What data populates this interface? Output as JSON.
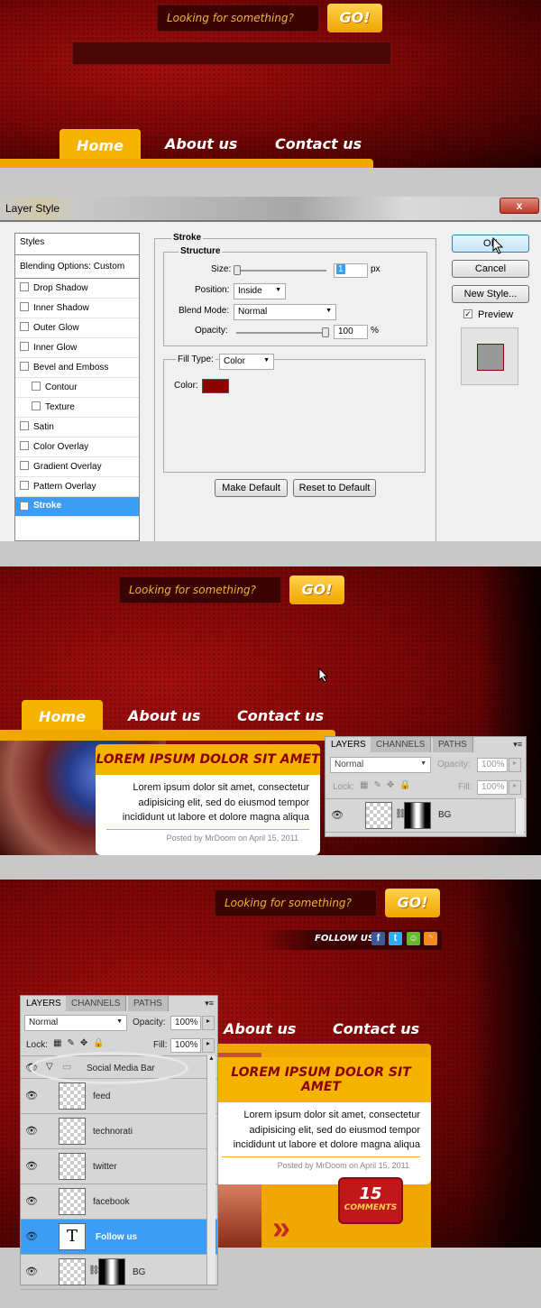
{
  "header": {
    "search_placeholder": "Looking for something?",
    "go_label": "GO!"
  },
  "nav": {
    "home": "Home",
    "about": "About us",
    "contact": "Contact us"
  },
  "dialog": {
    "title": "Layer Style",
    "close": "x",
    "styles_header": "Styles",
    "blending": "Blending Options: Custom",
    "items": [
      "Drop Shadow",
      "Inner Shadow",
      "Outer Glow",
      "Inner Glow",
      "Bevel and Emboss",
      "Contour",
      "Texture",
      "Satin",
      "Color Overlay",
      "Gradient Overlay",
      "Pattern Overlay",
      "Stroke"
    ],
    "stroke_title": "Stroke",
    "structure_title": "Structure",
    "size_label": "Size:",
    "size_value": "1",
    "size_unit": "px",
    "position_label": "Position:",
    "position_value": "Inside",
    "blend_label": "Blend Mode:",
    "blend_value": "Normal",
    "opacity_label": "Opacity:",
    "opacity_value": "100",
    "opacity_unit": "%",
    "filltype_label": "Fill Type:",
    "filltype_value": "Color",
    "color_label": "Color:",
    "stroke_color": "#8b0000",
    "make_default": "Make Default",
    "reset_default": "Reset to Default",
    "ok": "OK",
    "cancel": "Cancel",
    "new_style": "New Style...",
    "preview": "Preview"
  },
  "post": {
    "title": "LOREM IPSUM DOLOR SIT AMET",
    "text": "Lorem ipsum dolor sit amet, consectetur adipisicing elit, sed do eiusmod tempor incididunt ut labore et dolore magna aliqua",
    "meta": "Posted by MrDoom on April 15, 2011",
    "comments_count": "15",
    "comments_label": "COMMENTS"
  },
  "layers1": {
    "tabs": [
      "LAYERS",
      "CHANNELS",
      "PATHS"
    ],
    "blend": "Normal",
    "opacity_label": "Opacity:",
    "opacity": "100%",
    "lock_label": "Lock:",
    "fill_label": "Fill:",
    "fill": "100%",
    "bg_layer": "BG"
  },
  "follow": {
    "label": "FOLLOW US"
  },
  "layers2": {
    "tabs": [
      "LAYERS",
      "CHANNELS",
      "PATHS"
    ],
    "blend": "Normal",
    "opacity_label": "Opacity:",
    "opacity": "100%",
    "lock_label": "Lock:",
    "fill_label": "Fill:",
    "fill": "100%",
    "group": "Social Media Bar",
    "layers": [
      "feed",
      "technorati",
      "twitter",
      "facebook"
    ],
    "text_layer": "Follow us",
    "text_glyph": "T",
    "bg_layer": "BG"
  },
  "colors": {
    "accent": "#f5b300",
    "dark_red": "#8a0000",
    "selection": "#3d9df5"
  }
}
